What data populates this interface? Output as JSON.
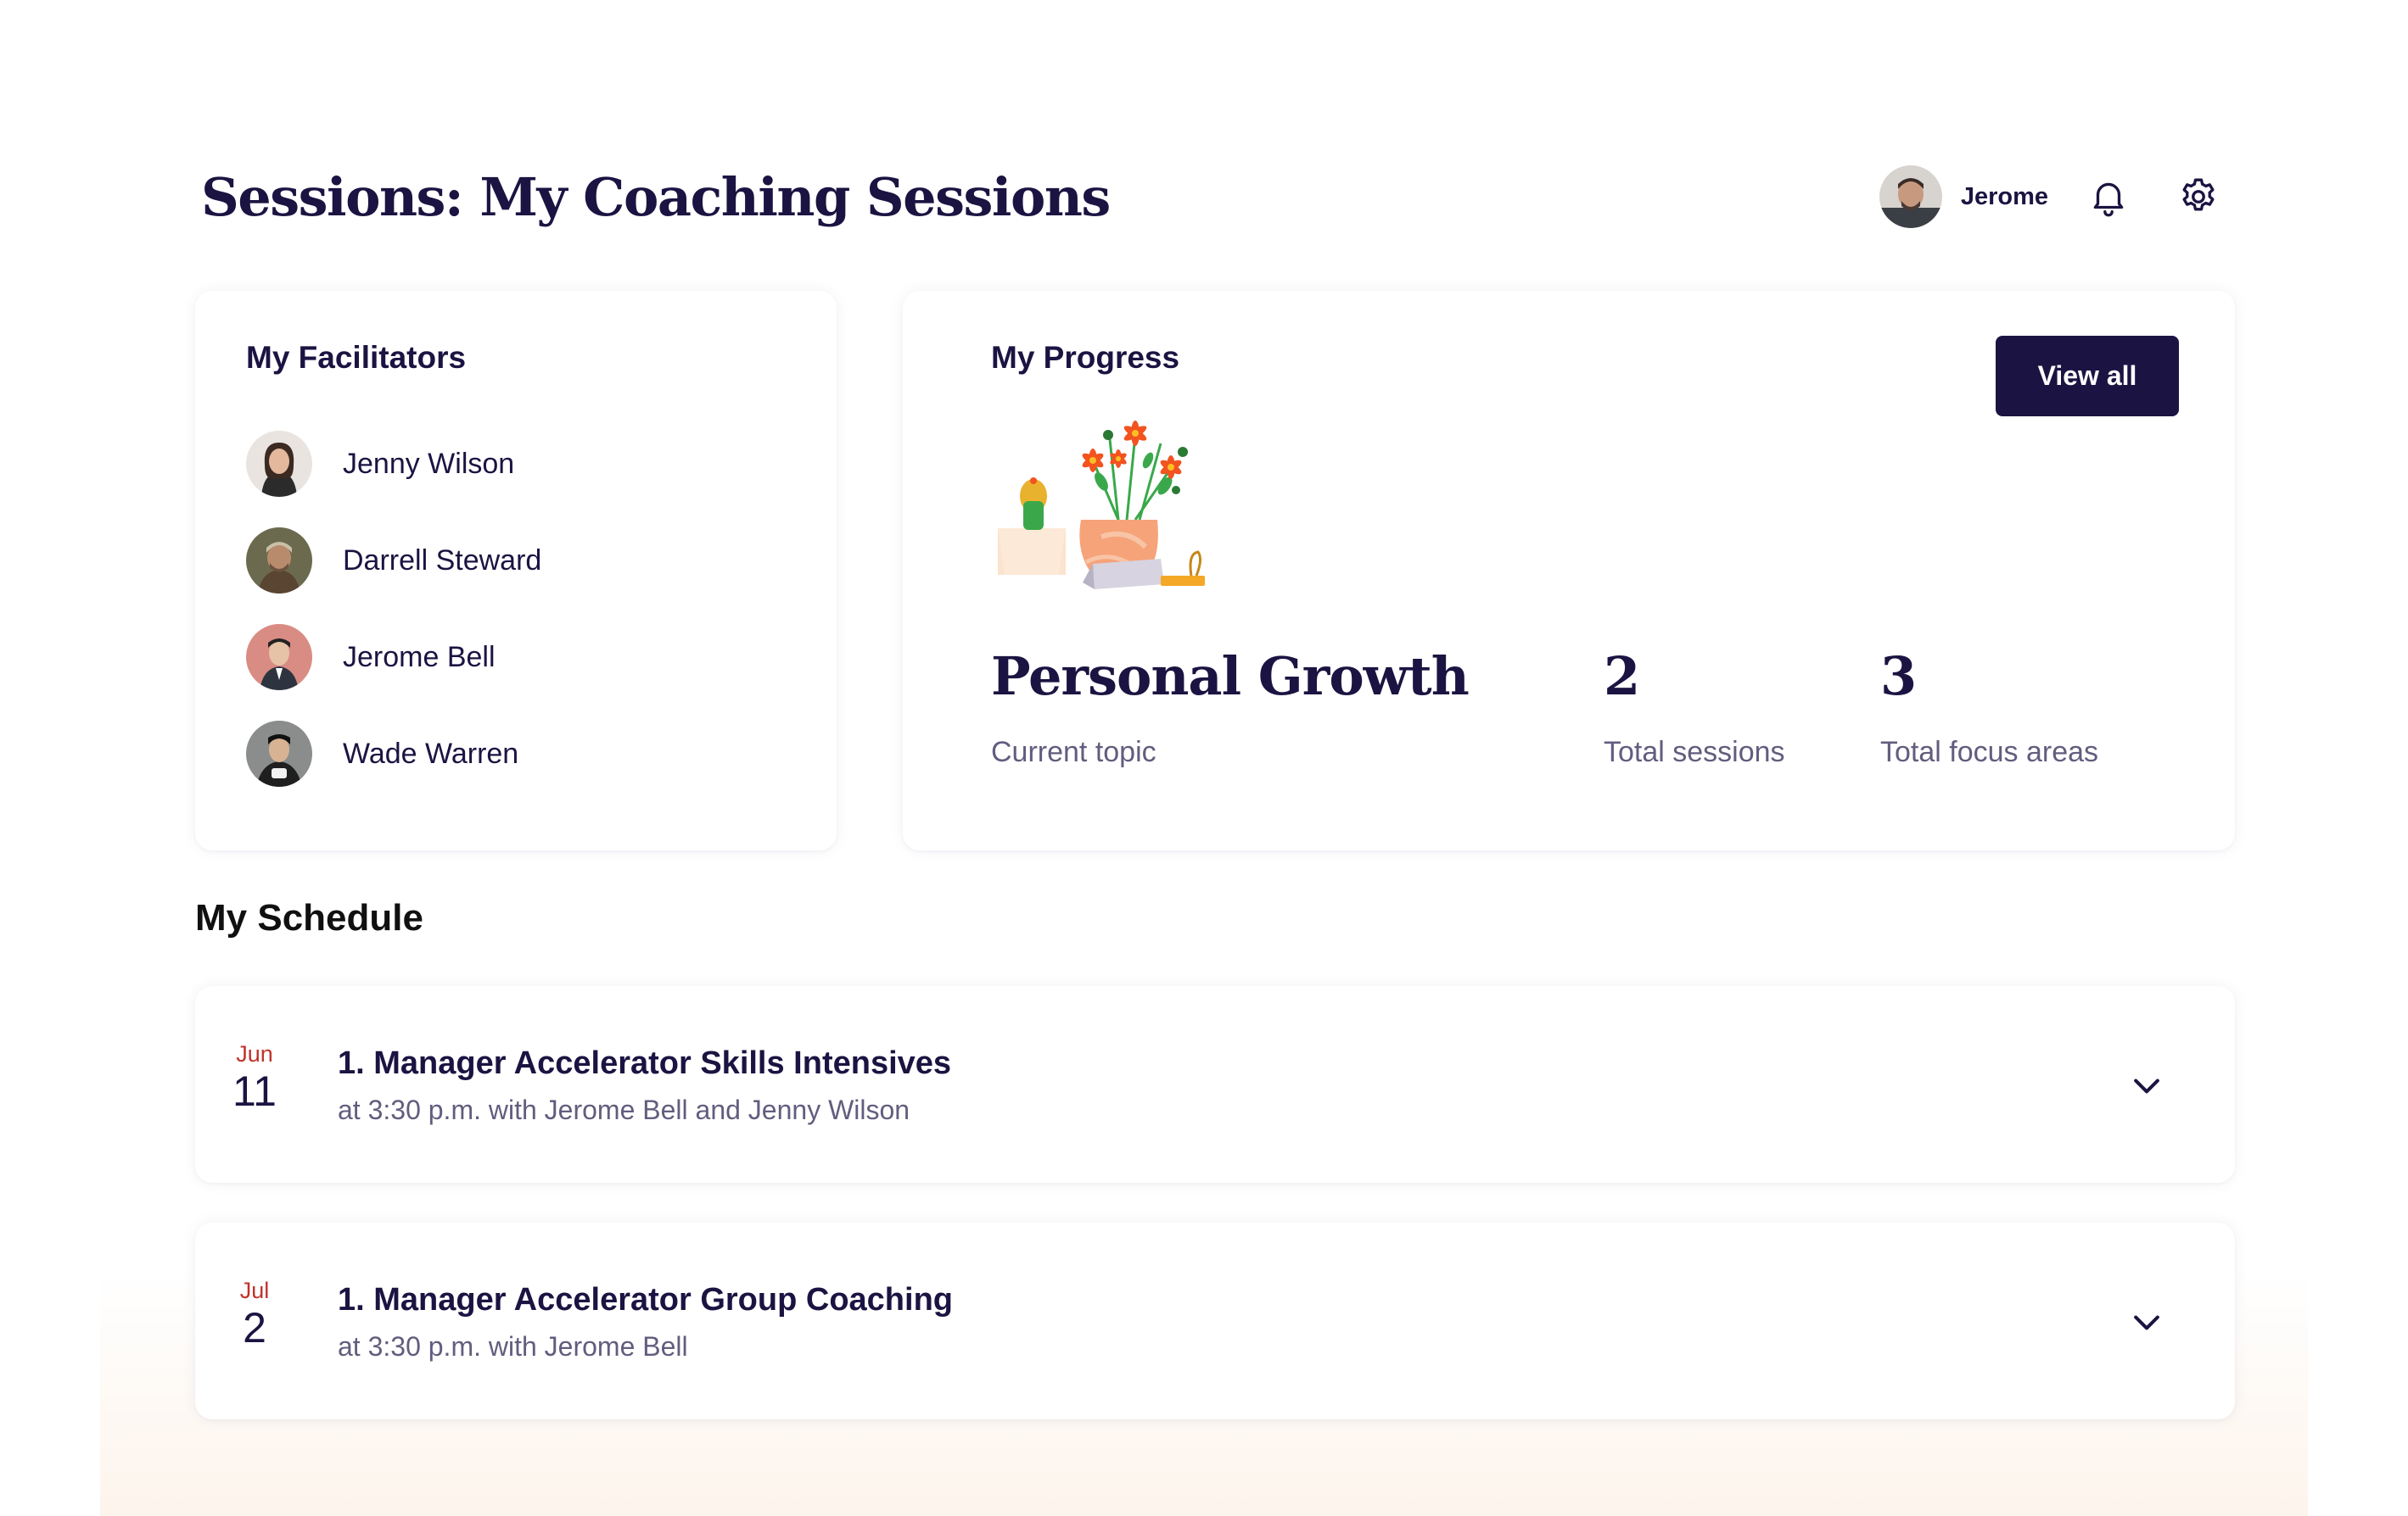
{
  "header": {
    "title": "Sessions: My Coaching Sessions",
    "user_name": "Jerome"
  },
  "icons": {
    "notifications": "bell-icon",
    "settings": "gear-icon",
    "expand": "chevron-down-icon"
  },
  "colors": {
    "brand_dark": "#1b1442",
    "date_month": "#c0322b",
    "muted_text": "#625d7e"
  },
  "facilitators": {
    "title": "My Facilitators",
    "items": [
      {
        "name": "Jenny Wilson"
      },
      {
        "name": "Darrell Steward"
      },
      {
        "name": "Jerome Bell"
      },
      {
        "name": "Wade Warren"
      }
    ]
  },
  "progress": {
    "title": "My Progress",
    "view_all_label": "View all",
    "current_topic": "Personal Growth",
    "current_topic_label": "Current topic",
    "total_sessions": "2",
    "total_sessions_label": "Total sessions",
    "total_focus_areas": "3",
    "total_focus_areas_label": "Total focus areas"
  },
  "schedule": {
    "title": "My Schedule",
    "sessions": [
      {
        "month": "Jun",
        "day": "11",
        "title": "1. Manager Accelerator Skills Intensives",
        "subtitle": "at 3:30 p.m. with Jerome Bell and Jenny Wilson"
      },
      {
        "month": "Jul",
        "day": "2",
        "title": "1. Manager Accelerator Group Coaching",
        "subtitle": "at 3:30 p.m. with Jerome Bell"
      }
    ]
  }
}
